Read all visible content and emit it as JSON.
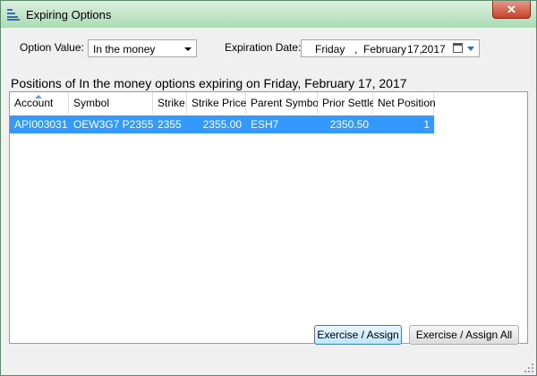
{
  "window": {
    "title": "Expiring Options",
    "close_label": "✕"
  },
  "filters": {
    "option_value_label": "Option Value:",
    "option_value_selected": "In the money",
    "expiration_label": "Expiration Date:",
    "date_day": "Friday",
    "date_sep": ",",
    "date_month": "February",
    "date_daynum": "17,",
    "date_year": "2017"
  },
  "heading": "Positions of In the money options expiring on Friday, February 17, 2017",
  "table": {
    "columns": [
      "Account",
      "Symbol",
      "Strike",
      "Strike Price",
      "Parent Symbol",
      "Prior Settle",
      "Net Position"
    ],
    "rows": [
      {
        "account": "API003031",
        "symbol": "OEW3G7 P2355",
        "strike": "2355",
        "strike_price": "2355.00",
        "parent_symbol": "ESH7",
        "prior_settle": "2350.50",
        "net_position": "1"
      }
    ],
    "selected_row_color": "#3399ff"
  },
  "buttons": {
    "exercise_assign": "Exercise / Assign",
    "exercise_assign_all": "Exercise / Assign All"
  }
}
